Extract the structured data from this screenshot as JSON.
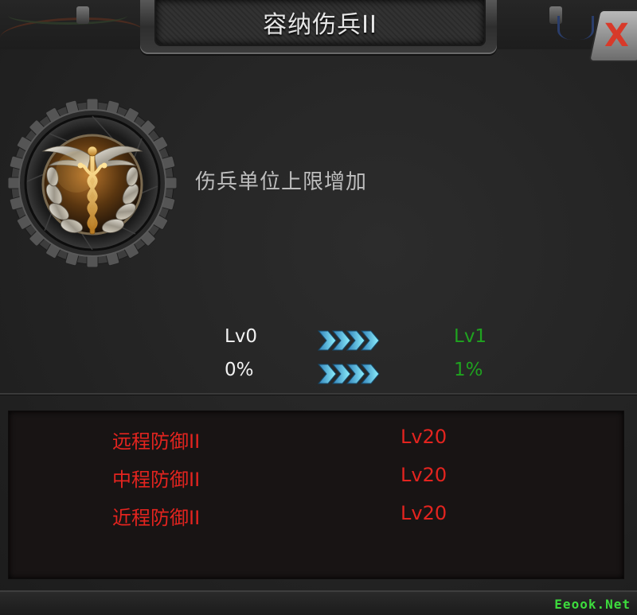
{
  "dialog": {
    "title": "容纳伤兵II",
    "close_label": "X"
  },
  "skill": {
    "icon": "caduceus-medical-badge-icon",
    "description": "伤兵单位上限增加"
  },
  "upgrade": {
    "rows": [
      {
        "from": "Lv0",
        "to": "Lv1"
      },
      {
        "from": "0%",
        "to": "1%"
      }
    ]
  },
  "requirements": [
    {
      "name": "远程防御II",
      "level": "Lv20"
    },
    {
      "name": "中程防御II",
      "level": "Lv20"
    },
    {
      "name": "近程防御II",
      "level": "Lv20"
    }
  ],
  "watermark": "Eeook.Net",
  "colors": {
    "current_value": "#f2f2f2",
    "next_value": "#1fa31f",
    "requirement_unmet": "#e3241f",
    "arrow": "#4fd0e6"
  }
}
